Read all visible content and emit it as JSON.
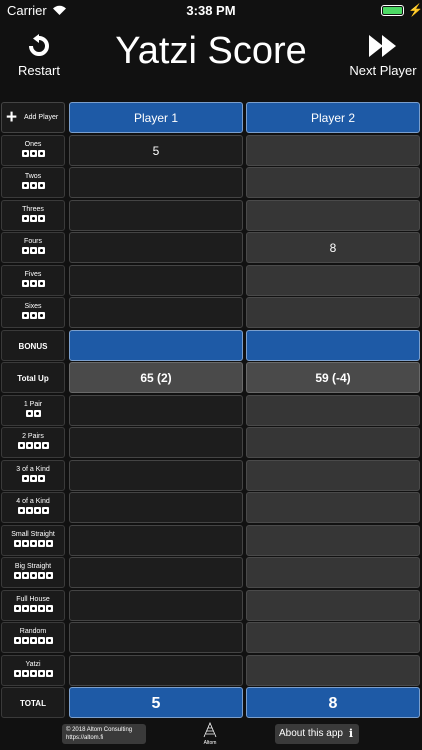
{
  "status": {
    "carrier": "Carrier",
    "time": "3:38 PM"
  },
  "header": {
    "restart_label": "Restart",
    "title": "Yatzi Score",
    "next_label": "Next Player"
  },
  "add_player_label": "Add Player",
  "players": [
    "Player 1",
    "Player 2"
  ],
  "rows": [
    {
      "label": "Ones",
      "dice": 3,
      "p1": "5",
      "p2": ""
    },
    {
      "label": "Twos",
      "dice": 3,
      "p1": "",
      "p2": ""
    },
    {
      "label": "Threes",
      "dice": 3,
      "p1": "",
      "p2": ""
    },
    {
      "label": "Fours",
      "dice": 3,
      "p1": "",
      "p2": "8"
    },
    {
      "label": "Fives",
      "dice": 3,
      "p1": "",
      "p2": ""
    },
    {
      "label": "Sixes",
      "dice": 3,
      "p1": "",
      "p2": ""
    },
    {
      "label": "BONUS",
      "dice": 0,
      "p1": "",
      "p2": ""
    },
    {
      "label": "Total Up",
      "dice": 0,
      "p1": "65 (2)",
      "p2": "59 (-4)"
    },
    {
      "label": "1 Pair",
      "dice": 2,
      "p1": "",
      "p2": ""
    },
    {
      "label": "2 Pairs",
      "dice": 4,
      "p1": "",
      "p2": ""
    },
    {
      "label": "3 of a Kind",
      "dice": 3,
      "p1": "",
      "p2": ""
    },
    {
      "label": "4 of a Kind",
      "dice": 4,
      "p1": "",
      "p2": ""
    },
    {
      "label": "Small Straight",
      "dice": 5,
      "p1": "",
      "p2": ""
    },
    {
      "label": "Big Straight",
      "dice": 5,
      "p1": "",
      "p2": ""
    },
    {
      "label": "Full House",
      "dice": 5,
      "p1": "",
      "p2": ""
    },
    {
      "label": "Random",
      "dice": 5,
      "p1": "",
      "p2": ""
    },
    {
      "label": "Yatzi",
      "dice": 5,
      "p1": "",
      "p2": ""
    },
    {
      "label": "TOTAL",
      "dice": 0,
      "p1": "5",
      "p2": "8"
    }
  ],
  "footer": {
    "copyright_line1": "© 2018 Altom Consulting",
    "copyright_line2": "https://altom.fi",
    "logo_text": "Altom",
    "about_label": "About this app",
    "about_icon": "i"
  },
  "colors": {
    "accent_blue": "#1e5aa6",
    "battery_green": "#4cd964"
  }
}
